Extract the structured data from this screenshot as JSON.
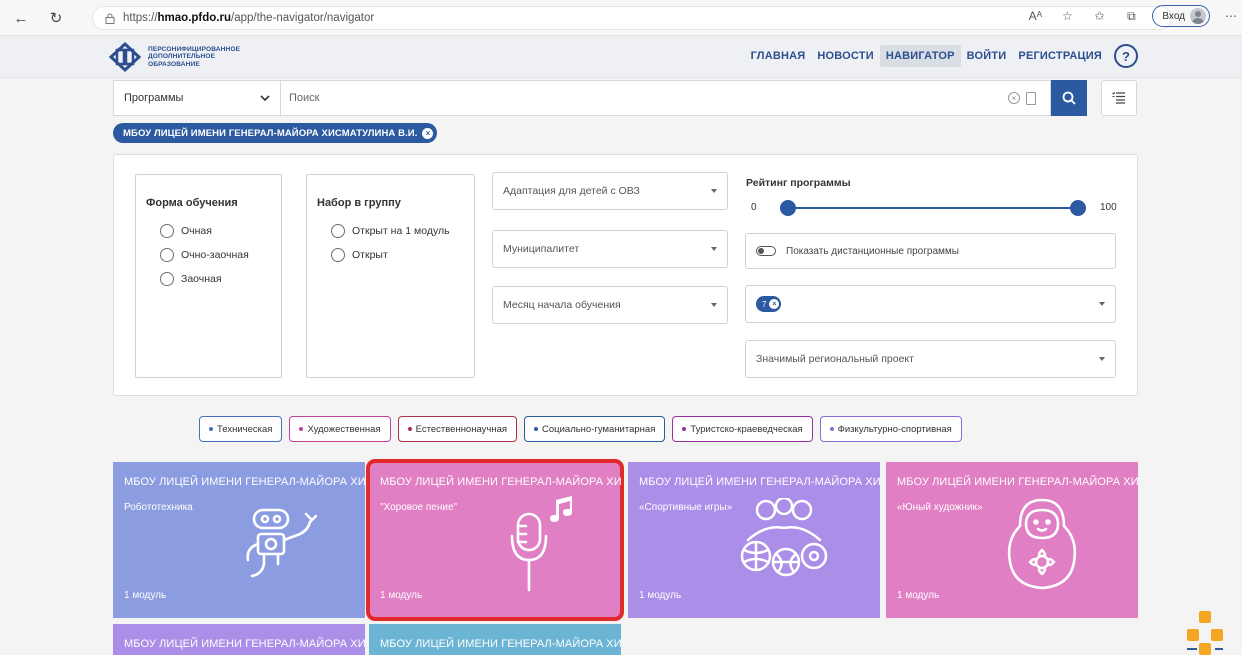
{
  "browser": {
    "url_prefix": "https://",
    "url_host": "hmao.pfdo.ru",
    "url_path": "/app/the-navigator/navigator",
    "reader_icon": "Aᴬ",
    "login_label": "Вход"
  },
  "header": {
    "logo_line1": "ПЕРСОНИФИЦИРОВАННОЕ",
    "logo_line2": "ДОПОЛНИТЕЛЬНОЕ",
    "logo_line3": "ОБРАЗОВАНИЕ",
    "nav": [
      {
        "label": "ГЛАВНАЯ",
        "active": false
      },
      {
        "label": "НОВОСТИ",
        "active": false
      },
      {
        "label": "НАВИГАТОР",
        "active": true
      },
      {
        "label": "ВОЙТИ",
        "active": false
      },
      {
        "label": "РЕГИСТРАЦИЯ",
        "active": false
      }
    ],
    "help_label": "?"
  },
  "search": {
    "category_value": "Программы",
    "placeholder": "Поиск"
  },
  "org_chip": "МБОУ ЛИЦЕЙ ИМЕНИ ГЕНЕРАЛ-МАЙОРА ХИСМАТУЛИНА В.И.",
  "filters": {
    "form": {
      "title": "Форма обучения",
      "options": [
        "Очная",
        "Очно-заочная",
        "Заочная"
      ]
    },
    "group": {
      "title": "Набор в группу",
      "options": [
        "Открыт на 1 модуль",
        "Открыт"
      ]
    },
    "dropdowns": {
      "adaptation": "Адаптация для детей с ОВЗ",
      "municipality": "Муниципалитет",
      "month": "Месяц начала обучения",
      "regional_project": "Значимый региональный проект"
    },
    "rating": {
      "title": "Рейтинг программы",
      "min_label": "0",
      "max_label": "100",
      "low": 0,
      "high": 100
    },
    "distance_label": "Показать дистанционные программы",
    "age_chip": "7"
  },
  "directions": [
    {
      "label": "Техническая",
      "color": "#4a6fc2"
    },
    {
      "label": "Художественная",
      "color": "#c0409a"
    },
    {
      "label": "Естественнонаучная",
      "color": "#a8324a"
    },
    {
      "label": "Социально-гуманитарная",
      "color": "#2c5aa0"
    },
    {
      "label": "Туристско-краеведческая",
      "color": "#9b2fa4"
    },
    {
      "label": "Физкультурно-спортивная",
      "color": "#8d6bd8"
    }
  ],
  "cards": [
    {
      "org": "МБОУ ЛИЦЕЙ ИМЕНИ ГЕНЕРАЛ-МАЙОРА ХИС",
      "name": "Робототехника",
      "modules": "1 модуль",
      "color": "#8b9de0",
      "icon": "robot-icon"
    },
    {
      "org": "МБОУ ЛИЦЕЙ ИМЕНИ ГЕНЕРАЛ-МАЙОРА ХИС",
      "name": "\"Хоровое пение\"",
      "modules": "1 модуль",
      "color": "#e07fc4",
      "icon": "microphone-icon"
    },
    {
      "org": "МБОУ ЛИЦЕЙ ИМЕНИ ГЕНЕРАЛ-МАЙОРА ХИС",
      "name": "«Спортивные игры»",
      "modules": "1 модуль",
      "color": "#ab8ee8",
      "icon": "sports-icon"
    },
    {
      "org": "МБОУ ЛИЦЕЙ ИМЕНИ ГЕНЕРАЛ-МАЙОРА ХИС",
      "name": "«Юный художник»",
      "modules": "1 модуль",
      "color": "#e07fc4",
      "icon": "matryoshka-icon"
    },
    {
      "org": "МБОУ ЛИЦЕЙ ИМЕНИ ГЕНЕРАЛ-МАЙОРА ХИС",
      "name": "",
      "modules": "",
      "color": "#ab8ee8",
      "icon": ""
    },
    {
      "org": "МБОУ ЛИЦЕЙ ИМЕНИ ГЕНЕРАЛ-МАЙОРА ХИС",
      "name": "",
      "modules": "",
      "color": "#6cb4d4",
      "icon": ""
    }
  ]
}
